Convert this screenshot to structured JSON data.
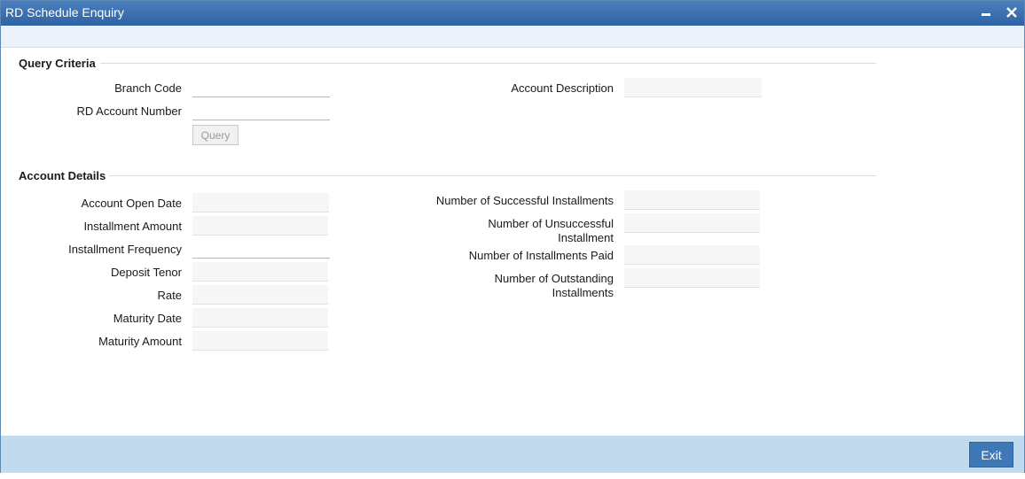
{
  "window": {
    "title": "RD Schedule Enquiry"
  },
  "query_criteria": {
    "heading": "Query Criteria",
    "branch_code": {
      "label": "Branch Code",
      "value": ""
    },
    "rd_account_number": {
      "label": "RD Account Number",
      "value": ""
    },
    "account_description": {
      "label": "Account Description",
      "value": ""
    },
    "query_button": "Query"
  },
  "account_details": {
    "heading": "Account Details",
    "account_open_date": {
      "label": "Account Open Date",
      "value": ""
    },
    "installment_amount": {
      "label": "Installment Amount",
      "value": ""
    },
    "installment_frequency": {
      "label": "Installment Frequency",
      "value": ""
    },
    "deposit_tenor": {
      "label": "Deposit Tenor",
      "value": ""
    },
    "rate": {
      "label": "Rate",
      "value": ""
    },
    "maturity_date": {
      "label": "Maturity Date",
      "value": ""
    },
    "maturity_amount": {
      "label": "Maturity Amount",
      "value": ""
    },
    "successful_installments": {
      "label": "Number of Successful Installments",
      "value": ""
    },
    "unsuccessful_installment": {
      "label_line1": "Number of Unsuccessful",
      "label_line2": "Installment",
      "value": ""
    },
    "installments_paid": {
      "label": "Number of Installments Paid",
      "value": ""
    },
    "outstanding_installments": {
      "label_line1": "Number of Outstanding",
      "label_line2": "Installments",
      "value": ""
    }
  },
  "footer": {
    "exit_button": "Exit"
  }
}
